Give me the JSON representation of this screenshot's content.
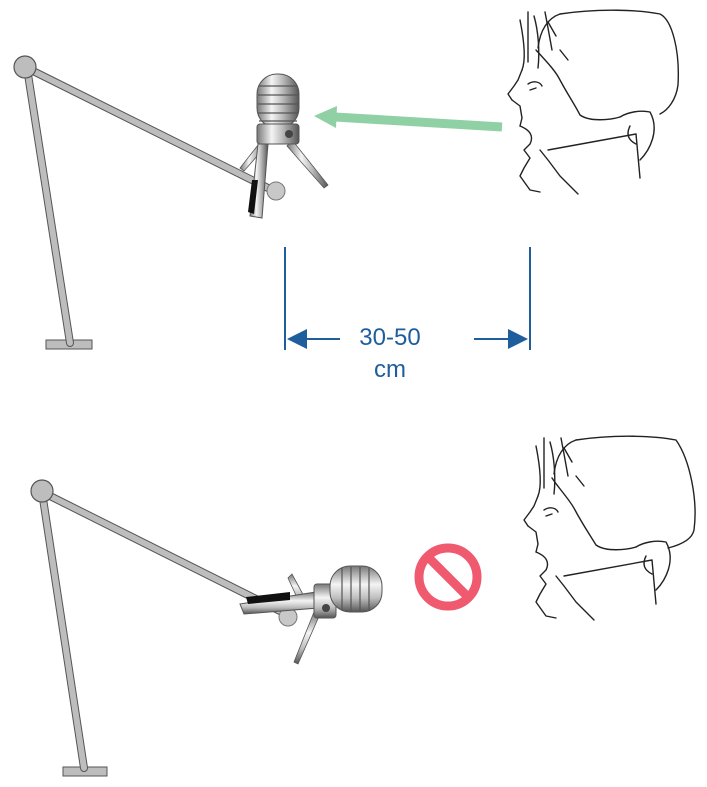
{
  "panels": [
    {
      "id": "correct",
      "arrow_color": "#8fd0a4"
    },
    {
      "id": "incorrect",
      "prohibited_color": "#ef5a6e"
    }
  ],
  "distance": {
    "label": "30-50 cm",
    "color": "#1f5e9c"
  },
  "colors": {
    "stand": "#bdbdbd",
    "stand_outline": "#555555",
    "mic_body": "#c9c9c9",
    "line_art": "#222222"
  },
  "icons": {
    "prohibited": "prohibited-icon",
    "microphone": "microphone-icon",
    "head": "head-profile-icon"
  }
}
